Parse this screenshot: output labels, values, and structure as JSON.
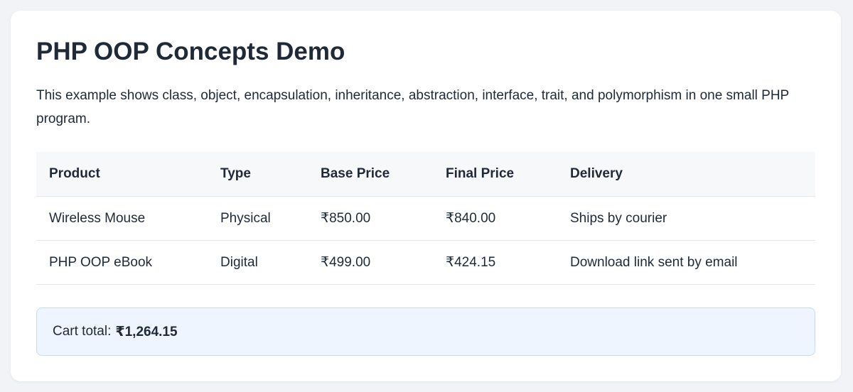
{
  "page": {
    "title": "PHP OOP Concepts Demo",
    "intro": "This example shows class, object, encapsulation, inheritance, abstraction, interface, trait, and polymorphism in one small PHP program."
  },
  "table": {
    "headers": [
      "Product",
      "Type",
      "Base Price",
      "Final Price",
      "Delivery"
    ],
    "rows": [
      [
        "Wireless Mouse",
        "Physical",
        "₹850.00",
        "₹840.00",
        "Ships by courier"
      ],
      [
        "PHP OOP eBook",
        "Digital",
        "₹499.00",
        "₹424.15",
        "Download link sent by email"
      ]
    ]
  },
  "cart": {
    "label": "Cart total:",
    "total": "₹1,264.15"
  }
}
